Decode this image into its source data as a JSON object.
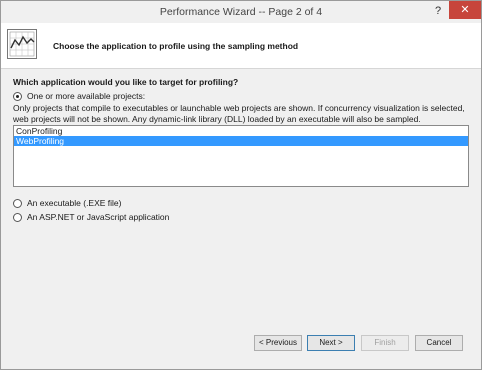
{
  "window": {
    "title": "Performance Wizard -- Page 2 of 4",
    "help_glyph": "?",
    "close_glyph": "✕"
  },
  "header": {
    "icon": "performance-chart-icon",
    "text": "Choose the application to profile using the sampling method"
  },
  "main": {
    "question": "Which application would you like to target for profiling?",
    "options": {
      "projects": "One or more available projects:",
      "executable": "An executable (.EXE file)",
      "aspnet": "An ASP.NET or JavaScript application"
    },
    "selected_option": "projects",
    "description": "Only projects that compile to executables or launchable web projects are shown. If concurrency visualization is selected, web projects will not be shown. Any dynamic-link library (DLL) loaded by an executable will also be sampled.",
    "projects": [
      {
        "label": "ConProfiling",
        "selected": false
      },
      {
        "label": "WebProfiling",
        "selected": true
      }
    ]
  },
  "buttons": {
    "previous": "< Previous",
    "next": "Next >",
    "finish": "Finish",
    "cancel": "Cancel"
  },
  "colors": {
    "selection": "#3399ff",
    "close_button": "#c7453b"
  }
}
